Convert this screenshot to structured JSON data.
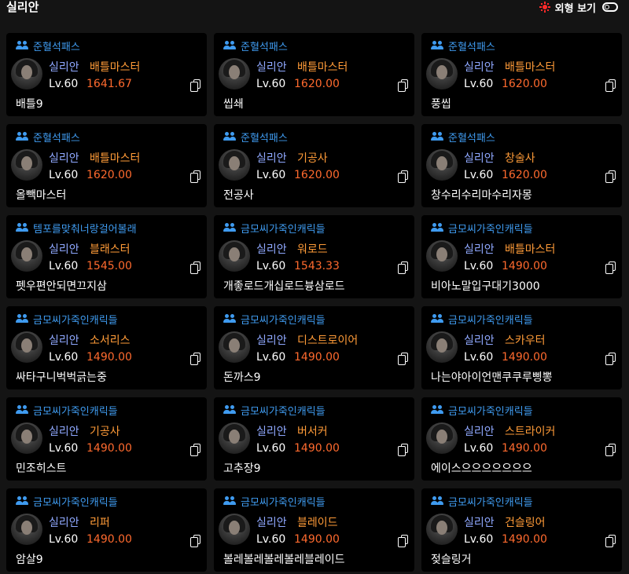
{
  "header": {
    "server_title": "실리안",
    "appearance_label": "외형 보기"
  },
  "colors": {
    "guild": "#3f9bf0",
    "server": "#8fa8ff",
    "class": "#ff9b38",
    "item_level": "#ff6a2e",
    "sun": "#ff2a2a"
  },
  "icons": {
    "guild": "users-icon",
    "copy": "copy-icon",
    "appearance": "sun-icon",
    "toggle": "toggle-icon"
  },
  "cards": [
    {
      "guild": "준혈석패스",
      "server": "실리안",
      "class": "배틀마스터",
      "level": "Lv.60",
      "ilvl": "1641.67",
      "name": "배틀9"
    },
    {
      "guild": "준혈석패스",
      "server": "실리안",
      "class": "배틀마스터",
      "level": "Lv.60",
      "ilvl": "1620.00",
      "name": "씹쇄"
    },
    {
      "guild": "준혈석패스",
      "server": "실리안",
      "class": "배틀마스터",
      "level": "Lv.60",
      "ilvl": "1620.00",
      "name": "풍씹"
    },
    {
      "guild": "준혈석패스",
      "server": "실리안",
      "class": "배틀마스터",
      "level": "Lv.60",
      "ilvl": "1620.00",
      "name": "올빽마스터"
    },
    {
      "guild": "준혈석패스",
      "server": "실리안",
      "class": "기공사",
      "level": "Lv.60",
      "ilvl": "1620.00",
      "name": "전공사"
    },
    {
      "guild": "준혈석패스",
      "server": "실리안",
      "class": "창술사",
      "level": "Lv.60",
      "ilvl": "1620.00",
      "name": "창수리수리마수리자몽"
    },
    {
      "guild": "템포를맞춰너랑걸어볼래",
      "server": "실리안",
      "class": "블래스터",
      "level": "Lv.60",
      "ilvl": "1545.00",
      "name": "펫우편안되면끄지삼"
    },
    {
      "guild": "금모씨가죽인캐릭들",
      "server": "실리안",
      "class": "워로드",
      "level": "Lv.60",
      "ilvl": "1543.33",
      "name": "개좋로드개십로드븅삼로드"
    },
    {
      "guild": "금모씨가죽인캐릭들",
      "server": "실리안",
      "class": "배틀마스터",
      "level": "Lv.60",
      "ilvl": "1490.00",
      "name": "비아노말입구대기3000"
    },
    {
      "guild": "금모씨가죽인캐릭들",
      "server": "실리안",
      "class": "소서리스",
      "level": "Lv.60",
      "ilvl": "1490.00",
      "name": "싸타구니벅벅긁는중"
    },
    {
      "guild": "금모씨가죽인캐릭들",
      "server": "실리안",
      "class": "디스트로이어",
      "level": "Lv.60",
      "ilvl": "1490.00",
      "name": "돈까스9"
    },
    {
      "guild": "금모씨가죽인캐릭들",
      "server": "실리안",
      "class": "스카우터",
      "level": "Lv.60",
      "ilvl": "1490.00",
      "name": "나는야아이언맨쿠쿠루삥뽕"
    },
    {
      "guild": "금모씨가죽인캐릭들",
      "server": "실리안",
      "class": "기공사",
      "level": "Lv.60",
      "ilvl": "1490.00",
      "name": "민조히스트"
    },
    {
      "guild": "금모씨가죽인캐릭들",
      "server": "실리안",
      "class": "버서커",
      "level": "Lv.60",
      "ilvl": "1490.00",
      "name": "고추장9"
    },
    {
      "guild": "금모씨가죽인캐릭들",
      "server": "실리안",
      "class": "스트라이커",
      "level": "Lv.60",
      "ilvl": "1490.00",
      "name": "에이스으으으으으으으"
    },
    {
      "guild": "금모씨가죽인캐릭들",
      "server": "실리안",
      "class": "리퍼",
      "level": "Lv.60",
      "ilvl": "1490.00",
      "name": "암살9"
    },
    {
      "guild": "금모씨가죽인캐릭들",
      "server": "실리안",
      "class": "블레이드",
      "level": "Lv.60",
      "ilvl": "1490.00",
      "name": "볼레볼레볼레볼레블레이드"
    },
    {
      "guild": "금모씨가죽인캐릭들",
      "server": "실리안",
      "class": "건슬링어",
      "level": "Lv.60",
      "ilvl": "1490.00",
      "name": "젖슬링거"
    }
  ]
}
